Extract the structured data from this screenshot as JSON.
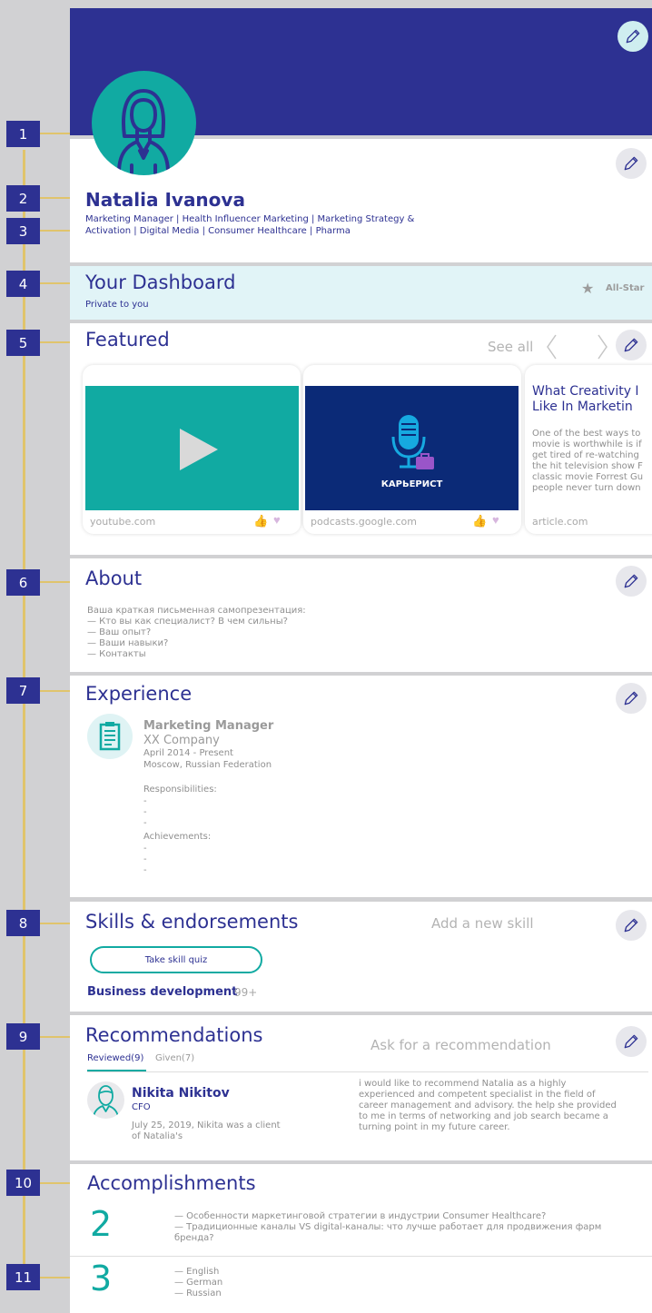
{
  "colors": {
    "brand": "#2d3192",
    "teal": "#11aaa2",
    "gold": "#e0c46c"
  },
  "callouts": [
    "1",
    "2",
    "3",
    "4",
    "5",
    "6",
    "7",
    "8",
    "9",
    "10",
    "11"
  ],
  "profile": {
    "name": "Natalia Ivanova",
    "headline_1": "Marketing Manager | Health Influencer Marketing | Marketing Strategy &",
    "headline_2": "Activation | Digital Media | Consumer Healthcare | Pharma"
  },
  "dashboard": {
    "title": "Your Dashboard",
    "subtitle": "Private to you",
    "badge": "All-Star"
  },
  "featured": {
    "title": "Featured",
    "see_all": "See all",
    "cards": [
      {
        "source": "youtube.com"
      },
      {
        "source": "podcasts.google.com",
        "podcast_label": "КАРЬЕРИСТ"
      },
      {
        "title_1": "What Creativity I",
        "title_2": "Like In Marketin",
        "lines": [
          "One of the best ways to",
          "movie is worthwhile is if",
          "get tired of re-watching",
          "the hit television show F",
          "classic movie Forrest Gu",
          "people never turn down"
        ],
        "source": "article.com"
      }
    ]
  },
  "about": {
    "title": "About",
    "lines": [
      "Ваша краткая письменная самопрезентация:",
      "— Кто вы как специалист? В чем сильны?",
      "— Ваш опыт?",
      "— Ваши навыки?",
      "— Контакты"
    ]
  },
  "experience": {
    "title": "Experience",
    "role": "Marketing Manager",
    "company": "XX Company",
    "dates": "April 2014 - Present",
    "location": "Moscow, Russian Federation",
    "responsibilities_label": "Responsibilities:",
    "achievements_label": "Achievements:",
    "dash": "-"
  },
  "skills": {
    "title": "Skills & endorsements",
    "add": "Add a new skill",
    "quiz": "Take skill quiz",
    "skill_name": "Business development",
    "skill_count": "99+"
  },
  "recommendations": {
    "title": "Recommendations",
    "ask": "Ask for a recommendation",
    "tab_reviewed": "Reviewed(9)",
    "tab_given": "Given(7)",
    "person": "Nikita Nikitov",
    "person_role": "CFO",
    "date_1": "July 25, 2019, Nikita was a client",
    "date_2": "of Natalia's",
    "text": [
      "i would like to recommend Natalia as a highly",
      "experienced and competent specialist in the field of",
      "career management and advisory. the help she provided",
      "to me in terms of networking and job search became a",
      "turning point in my future career."
    ]
  },
  "accomplishments": {
    "title": "Accomplishments",
    "count_1": "2",
    "items_1": [
      "— Особенности маркетинговой стратегии в индустрии Consumer Healthcare?",
      "— Традиционные каналы VS digital-каналы: что лучше работает для продвижения фарм",
      "бренда?"
    ],
    "count_2": "3",
    "items_2": [
      "— English",
      "— German",
      "— Russian"
    ]
  }
}
